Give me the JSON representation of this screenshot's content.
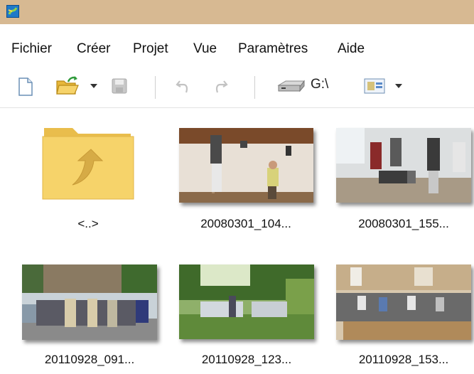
{
  "menu": {
    "items": [
      "Fichier",
      "Créer",
      "Projet",
      "Vue",
      "Paramètres",
      "Aide"
    ]
  },
  "toolbar": {
    "drive_label": "G:\\",
    "icons": [
      "new-file-icon",
      "open-folder-icon",
      "save-icon",
      "undo-icon",
      "redo-icon",
      "drive-icon",
      "view-mode-icon"
    ]
  },
  "files": [
    {
      "label": "<..>",
      "kind": "parent-folder"
    },
    {
      "label": "20080301_104...",
      "kind": "photo"
    },
    {
      "label": "20080301_155...",
      "kind": "photo"
    },
    {
      "label": "20110928_091...",
      "kind": "photo"
    },
    {
      "label": "20110928_123...",
      "kind": "photo"
    },
    {
      "label": "20110928_153...",
      "kind": "photo"
    }
  ],
  "colors": {
    "titlebar": "#d7b992",
    "folder": "#f6d36a"
  }
}
